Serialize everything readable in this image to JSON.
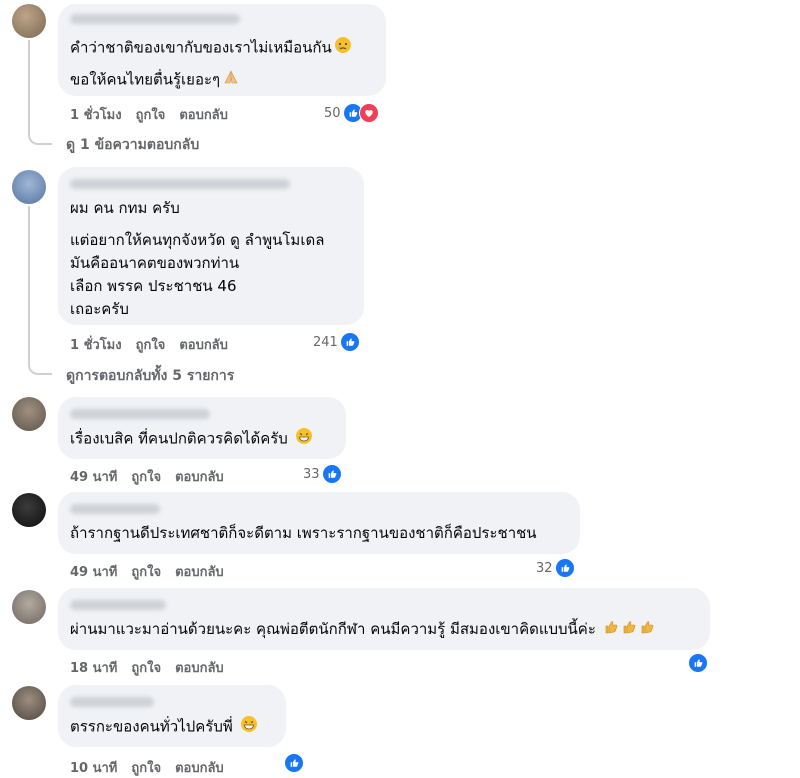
{
  "comments": [
    {
      "lines": [
        "คำว่าชาติของเขากับของเราไม่เหมือนกัน",
        "ขอให้คนไทยตื่นรู้เยอะๆ"
      ],
      "time": "1 ชั่วโมง",
      "like": "ถูกใจ",
      "reply": "ตอบกลับ",
      "reactions": "50",
      "reaction_icons": [
        "like-icon",
        "heart-icon"
      ]
    },
    {
      "lines": [
        "ผม คน กทม ครับ",
        "แต่อยากให้คนทุกจังหวัด ดู ลำพูนโมเดล",
        "มันคืออนาคตของพวกท่าน",
        "เลือก พรรค ประชาชน 46",
        "เถอะครับ"
      ],
      "time": "1 ชั่วโมง",
      "like": "ถูกใจ",
      "reply": "ตอบกลับ",
      "reactions": "241",
      "reaction_icons": [
        "like-icon"
      ]
    },
    {
      "lines": [
        "เรื่องเบสิค ที่คนปกติควรคิดได้ครับ"
      ],
      "time": "49 นาที",
      "like": "ถูกใจ",
      "reply": "ตอบกลับ",
      "reactions": "33",
      "reaction_icons": [
        "like-icon"
      ]
    },
    {
      "lines": [
        "ถ้ารากฐานดีประเทศชาติก็จะดีตาม เพราะรากฐานของชาติก็คือประชาชน"
      ],
      "time": "49 นาที",
      "like": "ถูกใจ",
      "reply": "ตอบกลับ",
      "reactions": "32",
      "reaction_icons": [
        "like-icon"
      ]
    },
    {
      "lines": [
        "ผ่านมาแวะมาอ่านด้วยนะคะ คุณพ่อตีตนักกีฬา คนมีความรู้ มีสมองเขาคิดแบบนี้ค่ะ"
      ],
      "time": "18 นาที",
      "like": "ถูกใจ",
      "reply": "ตอบกลับ",
      "reactions": "",
      "reaction_icons": [
        "like-icon"
      ]
    },
    {
      "lines": [
        "ตรรกะของคนทั่วไปครับพี่"
      ],
      "time": "10 นาที",
      "like": "ถูกใจ",
      "reply": "ตอบกลับ",
      "reactions": "",
      "reaction_icons": [
        "like-icon"
      ]
    }
  ],
  "view_replies": [
    "ดู 1 ข้อความตอบกลับ",
    "ดูการตอบกลับทั้ง 5 รายการ"
  ],
  "emojis": [
    "crying-face-emoji",
    "folded-hands-emoji",
    "grinning-face-emoji",
    "thumbs-up-emoji",
    "grinning-face-emoji"
  ],
  "colors": {
    "like": "#1877f2",
    "heart": "#f33e58",
    "bubble": "#f0f2f5",
    "meta": "#65676b"
  }
}
